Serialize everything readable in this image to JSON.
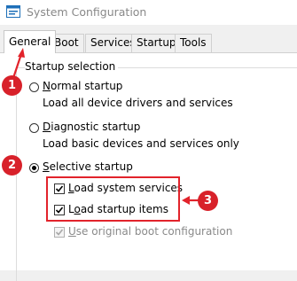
{
  "window": {
    "title": "System Configuration",
    "icon": "system-config-icon"
  },
  "tabs": [
    {
      "label": "General",
      "active": true
    },
    {
      "label": "Boot",
      "active": false
    },
    {
      "label": "Services",
      "active": false
    },
    {
      "label": "Startup",
      "active": false
    },
    {
      "label": "Tools",
      "active": false
    }
  ],
  "startup_selection": {
    "group_label": "Startup selection",
    "options": [
      {
        "pre": "",
        "mnemonic": "N",
        "rest": "ormal startup",
        "description": "Load all device drivers and services",
        "selected": false
      },
      {
        "pre": "",
        "mnemonic": "D",
        "rest": "iagnostic startup",
        "description": "Load basic devices and services only",
        "selected": false
      },
      {
        "pre": "",
        "mnemonic": "S",
        "rest": "elective startup",
        "description": "",
        "selected": true
      }
    ],
    "checkboxes": [
      {
        "pre": "",
        "mnemonic": "L",
        "rest": "oad system services",
        "checked": true,
        "enabled": true
      },
      {
        "pre": "L",
        "mnemonic": "o",
        "rest": "ad startup items",
        "checked": true,
        "enabled": true
      },
      {
        "pre": "",
        "mnemonic": "U",
        "rest": "se original boot configuration",
        "checked": true,
        "enabled": false
      }
    ]
  },
  "annotations": {
    "badges": [
      "1",
      "2",
      "3"
    ],
    "badge_color": "#d8212a",
    "arrow_color": "#e2232b"
  }
}
